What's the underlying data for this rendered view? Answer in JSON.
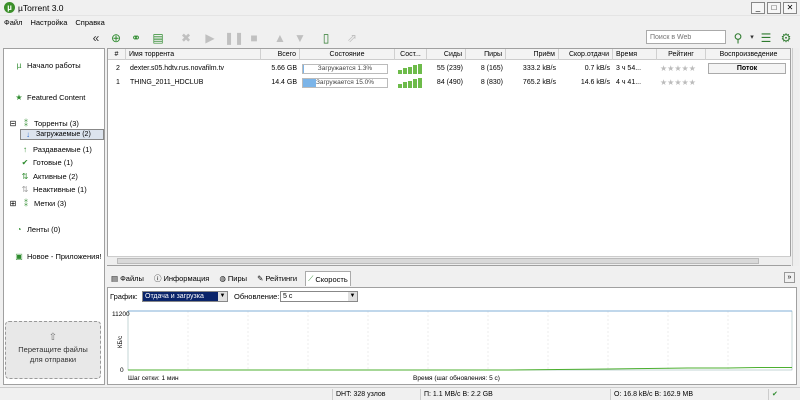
{
  "window": {
    "title": "µTorrent 3.0"
  },
  "menu": [
    "Файл",
    "Настройка",
    "Справка"
  ],
  "search": {
    "placeholder": "Поиск в Web"
  },
  "sidebar": {
    "start": "Начало работы",
    "featured": "Featured Content",
    "torrents": "Торренты (3)",
    "items": [
      {
        "label": "Загружаемые (2)"
      },
      {
        "label": "Раздаваемые (1)"
      },
      {
        "label": "Готовые (1)"
      },
      {
        "label": "Активные (2)"
      },
      {
        "label": "Неактивные (1)"
      }
    ],
    "labels": "Метки (3)",
    "feeds": "Ленты (0)",
    "apps": "Новое - Приложения!",
    "dropzone": "Перетащите файлы для отправки"
  },
  "columns": [
    "#",
    "Имя торрента",
    "Всего",
    "Состояние",
    "Сост...",
    "Сиды",
    "Пиры",
    "Приём",
    "Скор.отдачи",
    "Время",
    "Рейтинг",
    "Воспроизведение"
  ],
  "torrents": [
    {
      "num": "2",
      "name": "dexter.s05.hdtv.rus.novafilm.tv",
      "size": "5.66 GB",
      "status": "Загружается 1.3%",
      "progress": 0.013,
      "seeds": "55 (239)",
      "peers": "8 (165)",
      "down": "333.2 kB/s",
      "up": "0.7 kB/s",
      "eta": "3 ч 54...",
      "play": "Поток"
    },
    {
      "num": "1",
      "name": "THING_2011_HDCLUB",
      "size": "14.4 GB",
      "status": "Загружается 15.0%",
      "progress": 0.15,
      "seeds": "84 (490)",
      "peers": "8 (830)",
      "down": "765.2 kB/s",
      "up": "14.6 kB/s",
      "eta": "4 ч 41...",
      "play": ""
    }
  ],
  "tabs": [
    "Файлы",
    "Информация",
    "Пиры",
    "Рейтинги",
    "Скорость"
  ],
  "speed": {
    "graph_label": "График:",
    "graph_value": "Отдача и загрузка",
    "update_label": "Обновление:",
    "update_value": "5 с",
    "y_max": "11200",
    "y_min": "0",
    "y_unit": "КБ/с",
    "grid_step": "Шаг сетки: 1 мин",
    "time_label": "Время (шаг обновления: 5 с)"
  },
  "status": {
    "dht": "DHT: 328 узлов",
    "down": "П: 1.1 MB/с В: 2.2 GB",
    "up": "О: 16.8 kB/с В: 162.9 MB"
  }
}
